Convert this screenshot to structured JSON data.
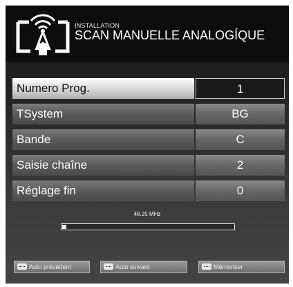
{
  "header": {
    "subtitle": "INSTALLATION",
    "title": "SCAN MANUELLE ANALOGÍQUE",
    "icon": "antenna-broadcast-icon"
  },
  "settings": [
    {
      "label": "Numero Prog.",
      "value": "1",
      "selected": true
    },
    {
      "label": "TSystem",
      "value": "BG",
      "selected": false
    },
    {
      "label": "Bande",
      "value": "C",
      "selected": false
    },
    {
      "label": "Saisie chaîne",
      "value": "2",
      "selected": false
    },
    {
      "label": "Réglage fin",
      "value": "0",
      "selected": false
    }
  ],
  "scan": {
    "frequency": "48.25 MHz",
    "progress": 0.02
  },
  "footer": {
    "buttons": [
      {
        "label": "Auto précédent",
        "key": "red-key-icon"
      },
      {
        "label": "Auto suivant",
        "key": "green-key-icon"
      },
      {
        "label": "Mémoriser",
        "key": "blue-key-icon"
      }
    ]
  }
}
